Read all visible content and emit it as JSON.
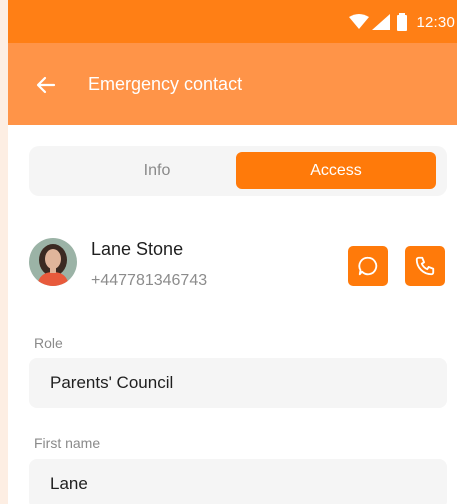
{
  "status_bar": {
    "time": "12:30",
    "icons": [
      "wifi-icon",
      "signal-icon",
      "battery-icon"
    ]
  },
  "app_bar": {
    "title": "Emergency contact",
    "back_icon": "arrow-left-icon"
  },
  "tabs": [
    {
      "label": "Info",
      "selected": false
    },
    {
      "label": "Access",
      "selected": true
    }
  ],
  "contact": {
    "name": "Lane Stone",
    "phone": "+447781346743",
    "actions": [
      "chat-icon",
      "phone-icon"
    ]
  },
  "fields": {
    "role": {
      "label": "Role",
      "value": "Parents' Council"
    },
    "first_name": {
      "label": "First name",
      "value": "Lane"
    }
  },
  "colors": {
    "status_bar": "#ff7f15",
    "app_bar": "#ff9448",
    "accent": "#ff7a0a",
    "field_bg": "#f5f5f5",
    "page_bg": "#fdeee3"
  }
}
